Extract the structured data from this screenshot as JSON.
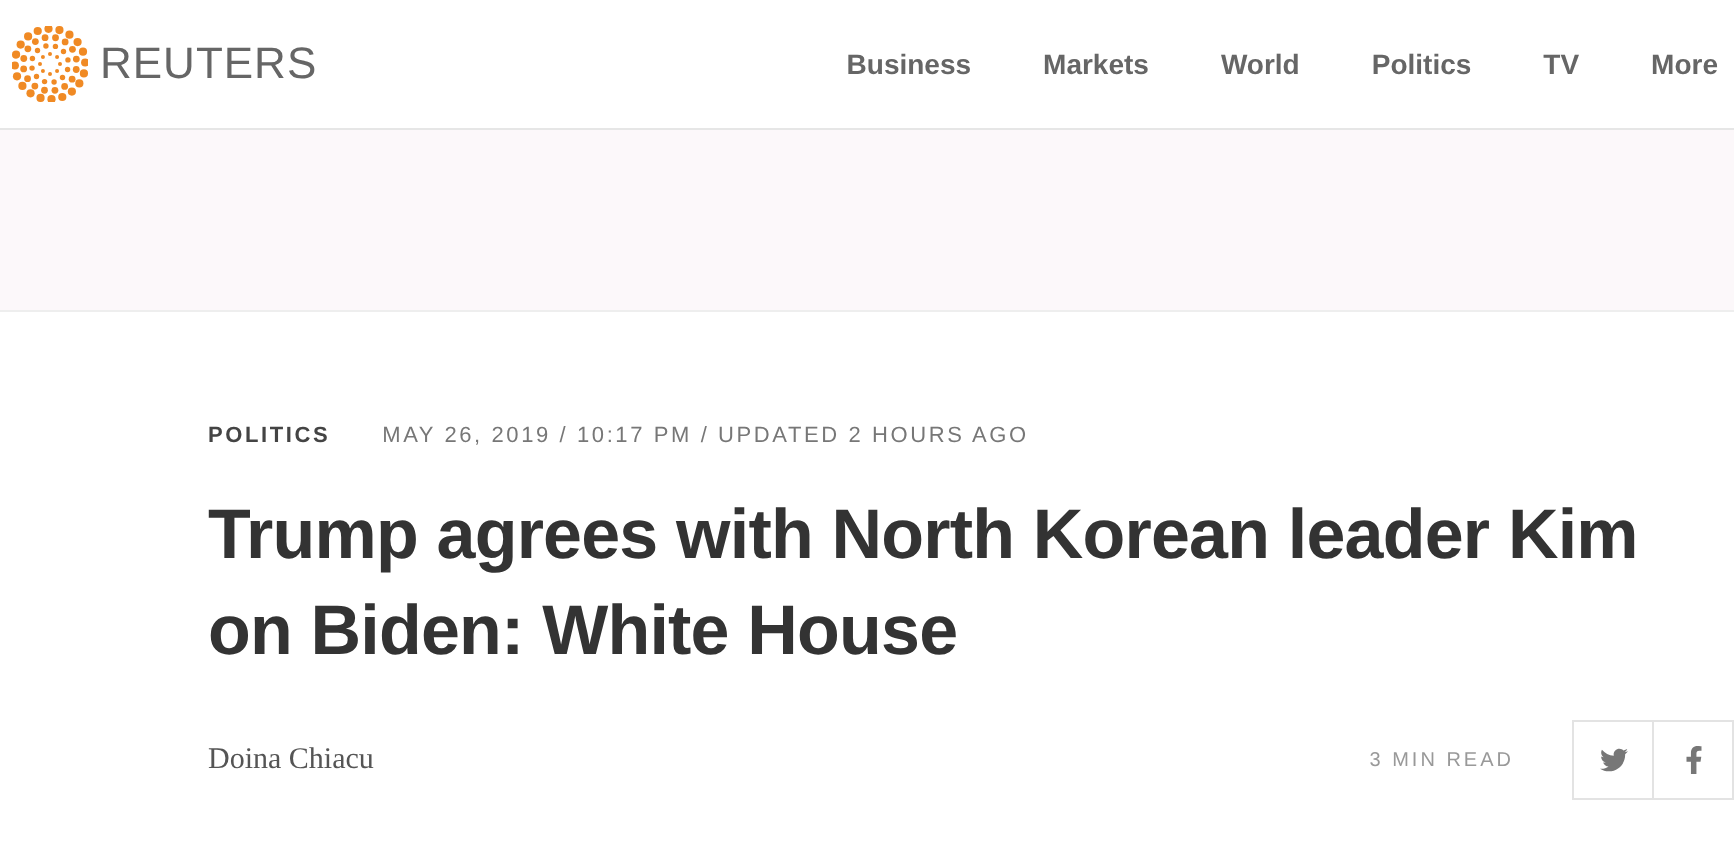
{
  "header": {
    "brand": "REUTERS",
    "nav": [
      "Business",
      "Markets",
      "World",
      "Politics",
      "TV",
      "More"
    ]
  },
  "article": {
    "section": "POLITICS",
    "dateline": "MAY 26, 2019 / 10:17 PM / UPDATED 2 HOURS AGO",
    "headline": "Trump agrees with North Korean leader Kim on Biden: White House",
    "byline": "Doina Chiacu",
    "read_time": "3 MIN READ"
  }
}
